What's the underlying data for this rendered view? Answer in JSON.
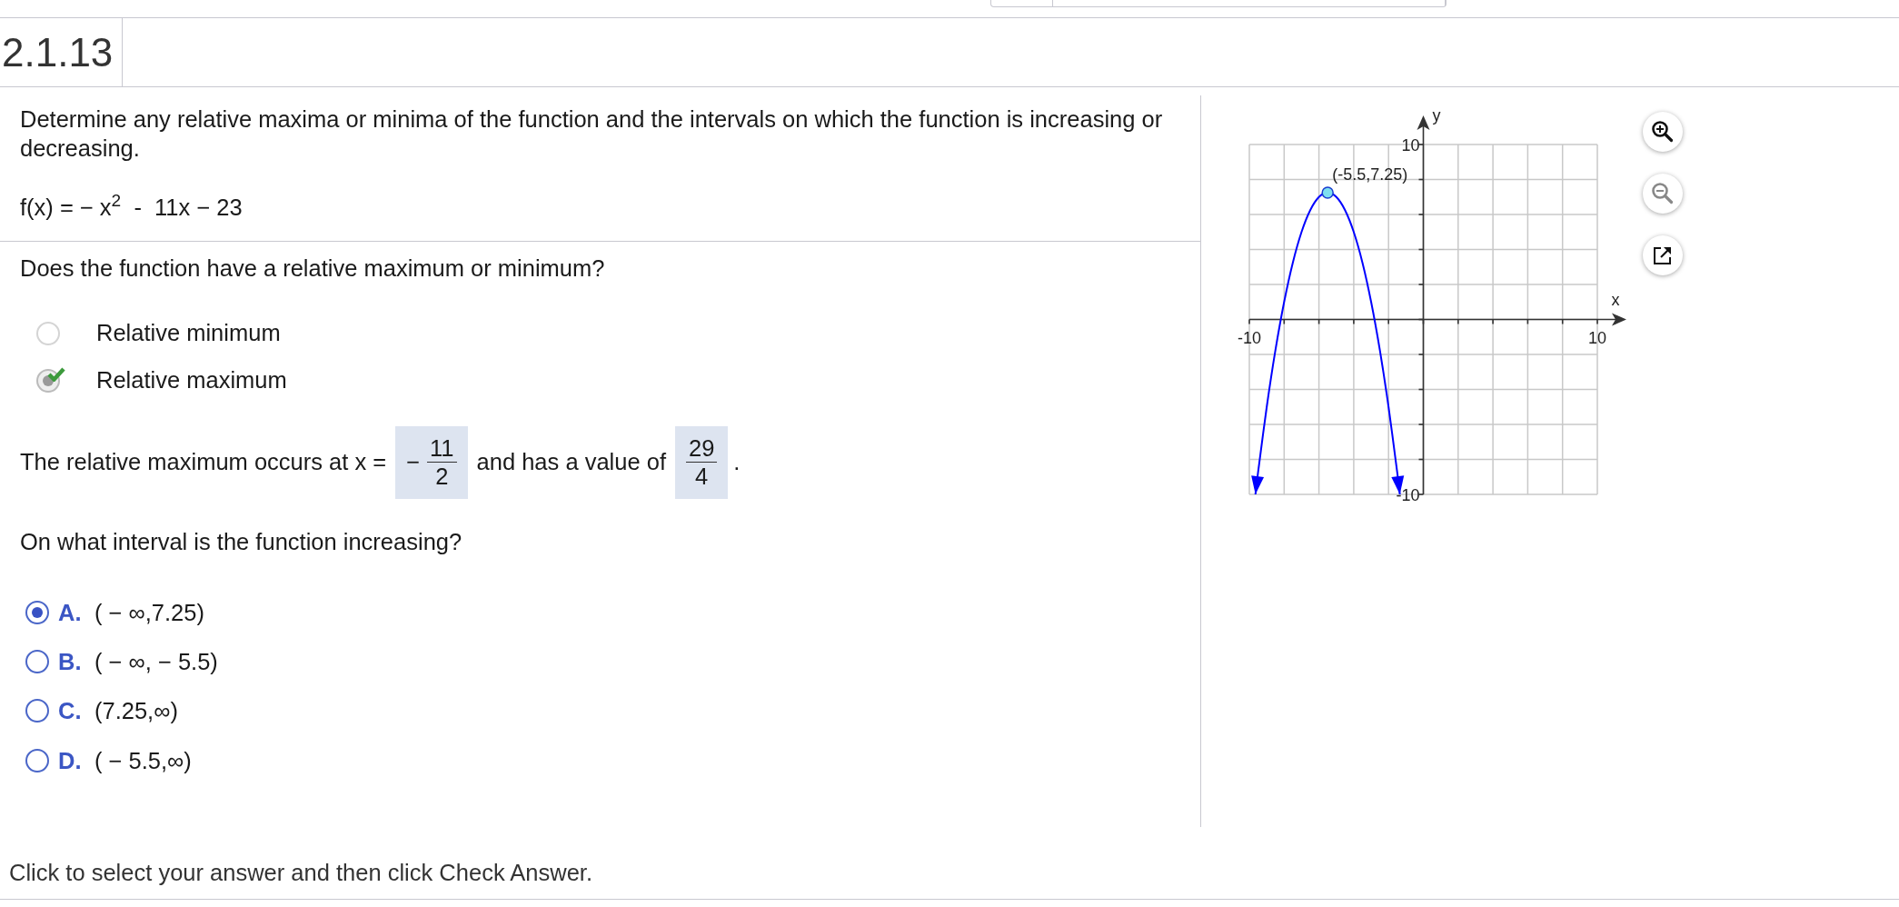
{
  "problem_number": "2.1.13",
  "instructions": "Determine any relative maxima or minima of the function and the intervals on which the function is increasing or decreasing.",
  "function": "f(x) = − x$^{2}$  -  11x − 23",
  "question_1": "Does the function have a relative maximum or minimum?",
  "extremum_options": [
    {
      "label": "Relative minimum",
      "selected": false,
      "correct": false
    },
    {
      "label": "Relative maximum",
      "selected": true,
      "correct": true
    }
  ],
  "sentence": {
    "part_1": "The relative maximum occurs at x =",
    "part_2": "and has a value of",
    "part_3": "."
  },
  "answers": [
    {
      "sign": "−",
      "numerator": "11",
      "denominator": "2"
    },
    {
      "numerator": "29",
      "denominator": "4"
    }
  ],
  "question_2": "On what interval is the function increasing?",
  "interval_options": [
    {
      "letter": "A.",
      "text": "( − ∞,7.25)",
      "selected": true
    },
    {
      "letter": "B.",
      "text": "( − ∞, − 5.5)",
      "selected": false
    },
    {
      "letter": "C.",
      "text": "(7.25,∞)",
      "selected": false
    },
    {
      "letter": "D.",
      "text": "( − 5.5,∞)",
      "selected": false
    }
  ],
  "graph": {
    "point_label": "(-5.5,7.25)",
    "chart_data": {
      "type": "line",
      "xlabel": "x",
      "ylabel": "y",
      "xlim": [
        -10,
        10
      ],
      "ylim": [
        -10,
        10
      ],
      "xticks": [
        -10,
        10
      ],
      "yticks": [
        -10,
        10
      ],
      "x": [
        -9.65,
        -9.5,
        -9,
        -8.5,
        -8,
        -7.5,
        -7,
        -6.5,
        -6,
        -5.5,
        -5,
        -4.5,
        -4,
        -3.5,
        -3,
        -2.5,
        -2,
        -1.5,
        -1.35
      ],
      "series": [
        {
          "color": "#0000ff",
          "values": [
            -10,
            -8.75,
            -5,
            -1.75,
            1,
            3.25,
            5,
            6.25,
            7,
            7.25,
            7,
            6.25,
            5,
            3.25,
            1,
            -1.75,
            -5,
            -8.75,
            -10
          ]
        }
      ]
    }
  },
  "footer": "Click to select your answer and then click Check Answer."
}
